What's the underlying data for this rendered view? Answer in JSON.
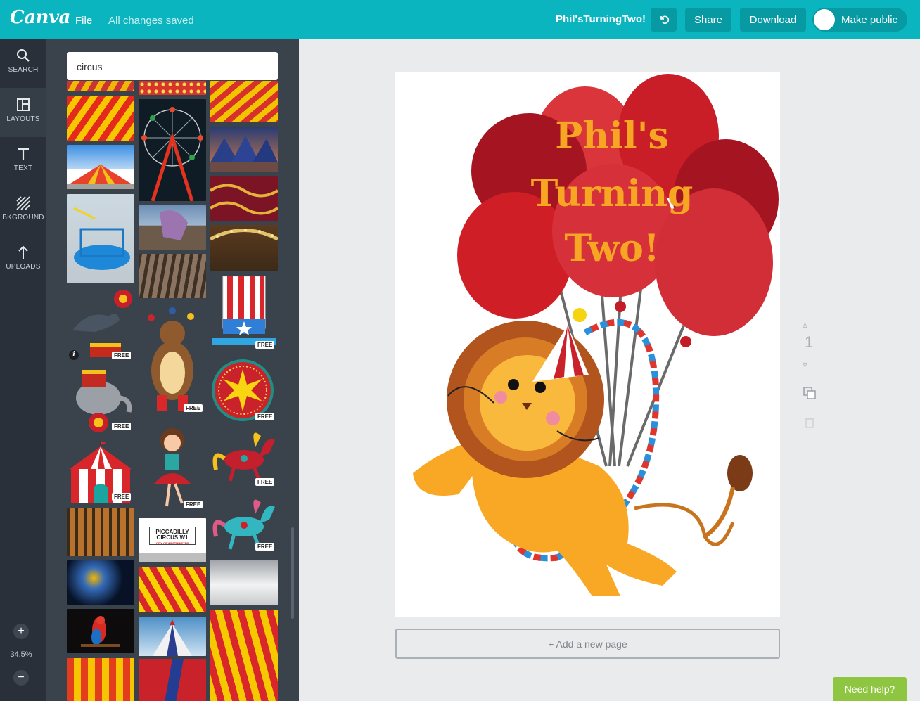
{
  "topbar": {
    "logo": "Canva",
    "file_label": "File",
    "status": "All changes saved",
    "doc_title": "Phil'sTurningTwo!",
    "undo_icon": "undo-icon",
    "share_label": "Share",
    "download_label": "Download",
    "public_label": "Make public"
  },
  "rail": {
    "items": [
      {
        "label": "SEARCH",
        "icon": "search-icon"
      },
      {
        "label": "LAYOUTS",
        "icon": "layouts-icon"
      },
      {
        "label": "TEXT",
        "icon": "text-icon"
      },
      {
        "label": "BKGROUND",
        "icon": "background-icon"
      },
      {
        "label": "UPLOADS",
        "icon": "upload-icon"
      }
    ],
    "zoom": {
      "plus": "+",
      "value": "34.5%",
      "minus": "−"
    }
  },
  "panel": {
    "search_value": "circus",
    "free_badge": "FREE",
    "info_glyph": "i",
    "piccadilly_line1": "PICCADILLY",
    "piccadilly_line2": "CIRCUS W1",
    "piccadilly_line3": "CITY OF WESTMINSTER"
  },
  "design": {
    "line1": "Phil's",
    "line2": "Turning",
    "line3": "Two!"
  },
  "canvas": {
    "add_page": "+ Add a new page",
    "page_number": "1"
  },
  "help_label": "Need help?",
  "colors": {
    "brand": "#0bb5c0",
    "rail": "#293039",
    "panel": "#3a424c",
    "balloon_red": "#c9222b",
    "text_orange": "#f6a623",
    "help_green": "#8fc641"
  }
}
